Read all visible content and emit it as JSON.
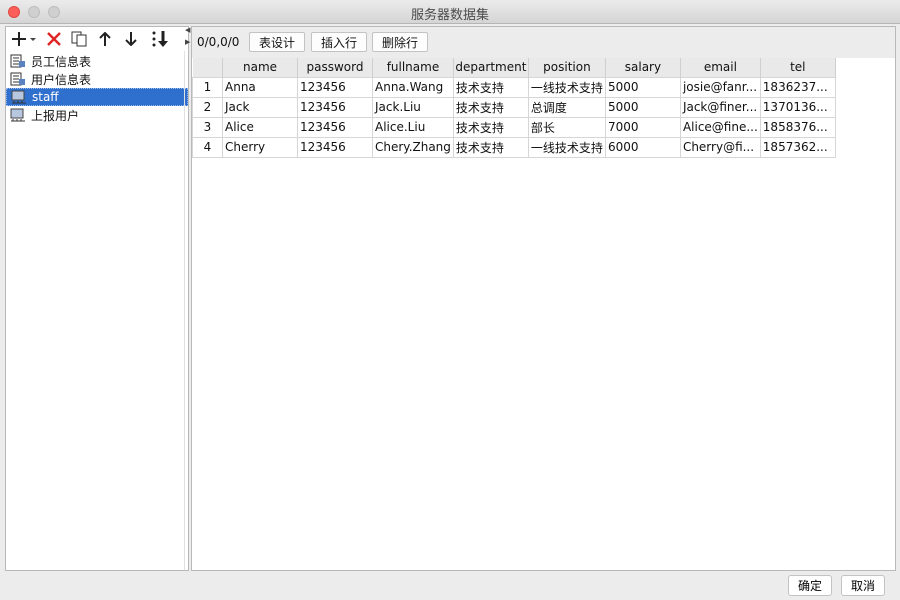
{
  "window": {
    "title": "服务器数据集"
  },
  "tree": {
    "items": [
      {
        "label": "员工信息表",
        "icon": "db-table-icon"
      },
      {
        "label": "用户信息表",
        "icon": "db-table-icon"
      },
      {
        "label": "staff",
        "icon": "server-table-icon",
        "selected": true
      },
      {
        "label": "上报用户",
        "icon": "server-table-icon"
      }
    ]
  },
  "toolbar": {
    "coords": "0/0,0/0",
    "design_label": "表设计",
    "insert_label": "插入行",
    "delete_label": "删除行"
  },
  "table": {
    "columns": [
      "name",
      "password",
      "fullname",
      "department",
      "position",
      "salary",
      "email",
      "tel"
    ],
    "rows": [
      {
        "n": "1",
        "cells": [
          "Anna",
          "123456",
          "Anna.Wang",
          "技术支持",
          "一线技术支持",
          "5000",
          "josie@fanr...",
          "1836237..."
        ]
      },
      {
        "n": "2",
        "cells": [
          "Jack",
          "123456",
          "Jack.Liu",
          "技术支持",
          "总调度",
          "5000",
          "Jack@finer...",
          "1370136..."
        ]
      },
      {
        "n": "3",
        "cells": [
          "Alice",
          "123456",
          "Alice.Liu",
          "技术支持",
          "部长",
          "7000",
          "Alice@fine...",
          "1858376..."
        ]
      },
      {
        "n": "4",
        "cells": [
          "Cherry",
          "123456",
          "Chery.Zhang",
          "技术支持",
          "一线技术支持",
          "6000",
          "Cherry@fi...",
          "1857362..."
        ]
      }
    ]
  },
  "footer": {
    "ok_label": "确定",
    "cancel_label": "取消"
  },
  "colors": {
    "selection": "#2f6fce",
    "close": "#fc5f57",
    "delete": "#e02424"
  }
}
